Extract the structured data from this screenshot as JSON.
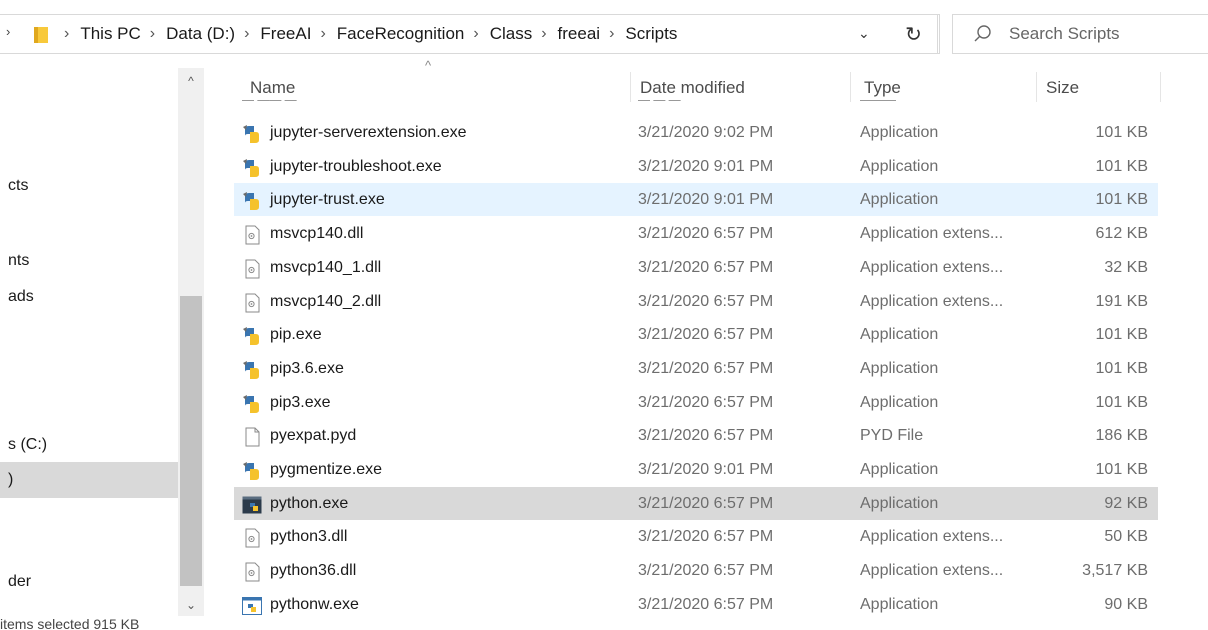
{
  "address_bar": {
    "crumbs": [
      "This PC",
      "Data (D:)",
      "FreeAI",
      "FaceRecognition",
      "Class",
      "freeai",
      "Scripts"
    ],
    "separator": "›"
  },
  "search": {
    "placeholder": "Search Scripts"
  },
  "nav_pane": {
    "items": [
      "cts",
      "nts",
      "ads",
      "s (C:)",
      ")",
      "der"
    ],
    "selected_index": 4
  },
  "status_text": "items selected 915 KB",
  "columns": {
    "name": "Name",
    "date": "Date modified",
    "type": "Type",
    "size": "Size"
  },
  "files": [
    {
      "name": "jupyter-serverextension.exe",
      "date": "3/21/2020 9:02 PM",
      "type": "Application",
      "size": "101 KB",
      "icon": "python-exe-icon",
      "state": ""
    },
    {
      "name": "jupyter-troubleshoot.exe",
      "date": "3/21/2020 9:01 PM",
      "type": "Application",
      "size": "101 KB",
      "icon": "python-exe-icon",
      "state": ""
    },
    {
      "name": "jupyter-trust.exe",
      "date": "3/21/2020 9:01 PM",
      "type": "Application",
      "size": "101 KB",
      "icon": "python-exe-icon",
      "state": "hover"
    },
    {
      "name": "msvcp140.dll",
      "date": "3/21/2020 6:57 PM",
      "type": "Application extens...",
      "size": "612 KB",
      "icon": "dll-icon",
      "state": ""
    },
    {
      "name": "msvcp140_1.dll",
      "date": "3/21/2020 6:57 PM",
      "type": "Application extens...",
      "size": "32 KB",
      "icon": "dll-icon",
      "state": ""
    },
    {
      "name": "msvcp140_2.dll",
      "date": "3/21/2020 6:57 PM",
      "type": "Application extens...",
      "size": "191 KB",
      "icon": "dll-icon",
      "state": ""
    },
    {
      "name": "pip.exe",
      "date": "3/21/2020 6:57 PM",
      "type": "Application",
      "size": "101 KB",
      "icon": "python-exe-icon",
      "state": ""
    },
    {
      "name": "pip3.6.exe",
      "date": "3/21/2020 6:57 PM",
      "type": "Application",
      "size": "101 KB",
      "icon": "python-exe-icon",
      "state": ""
    },
    {
      "name": "pip3.exe",
      "date": "3/21/2020 6:57 PM",
      "type": "Application",
      "size": "101 KB",
      "icon": "python-exe-icon",
      "state": ""
    },
    {
      "name": "pyexpat.pyd",
      "date": "3/21/2020 6:57 PM",
      "type": "PYD File",
      "size": "186 KB",
      "icon": "blank-file-icon",
      "state": ""
    },
    {
      "name": "pygmentize.exe",
      "date": "3/21/2020 9:01 PM",
      "type": "Application",
      "size": "101 KB",
      "icon": "python-exe-icon",
      "state": ""
    },
    {
      "name": "python.exe",
      "date": "3/21/2020 6:57 PM",
      "type": "Application",
      "size": "92 KB",
      "icon": "python-console-icon",
      "state": "selected"
    },
    {
      "name": "python3.dll",
      "date": "3/21/2020 6:57 PM",
      "type": "Application extens...",
      "size": "50 KB",
      "icon": "dll-icon",
      "state": ""
    },
    {
      "name": "python36.dll",
      "date": "3/21/2020 6:57 PM",
      "type": "Application extens...",
      "size": "3,517 KB",
      "icon": "dll-icon",
      "state": ""
    },
    {
      "name": "pythonw.exe",
      "date": "3/21/2020 6:57 PM",
      "type": "Application",
      "size": "90 KB",
      "icon": "python-window-icon",
      "state": ""
    }
  ],
  "colors": {
    "hover_row": "#e5f3ff",
    "selected_row": "#d9d9d9",
    "folder_yellow": "#f8c93b",
    "python_blue": "#3a75b0",
    "python_yellow": "#f5c22c"
  }
}
